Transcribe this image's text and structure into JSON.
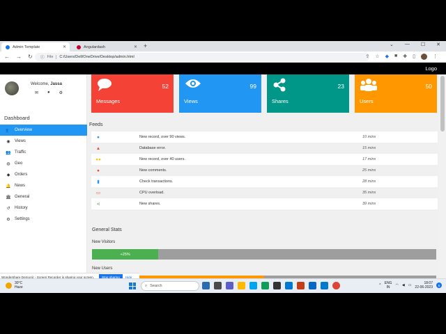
{
  "browser": {
    "tabs": [
      {
        "label": "Admin Template",
        "active": true,
        "favicon_color": "#1a73e8"
      },
      {
        "label": "Angulardash",
        "active": false,
        "favicon_color": "#c3002f"
      }
    ],
    "file_label": "File",
    "url": "C:/Users/Dell/OneDrive/Desktop/admin.html"
  },
  "topbar": {
    "logo": "Logo"
  },
  "sidebar": {
    "welcome_prefix": "Welcome, ",
    "user_name": "Jassa",
    "section_title": "Dashboard",
    "items": [
      {
        "label": "Overview",
        "icon": "users-icon",
        "active": true
      },
      {
        "label": "Views",
        "icon": "eye-icon",
        "active": false
      },
      {
        "label": "Traffic",
        "icon": "users-icon",
        "active": false
      },
      {
        "label": "Geo",
        "icon": "globe-icon",
        "active": false
      },
      {
        "label": "Orders",
        "icon": "diamond-icon",
        "active": false
      },
      {
        "label": "News",
        "icon": "bell-icon",
        "active": false
      },
      {
        "label": "General",
        "icon": "bank-icon",
        "active": false
      },
      {
        "label": "History",
        "icon": "history-icon",
        "active": false
      },
      {
        "label": "Settings",
        "icon": "gear-icon",
        "active": false
      }
    ]
  },
  "cards": [
    {
      "label": "Messages",
      "value": "52",
      "color": "#f44336",
      "icon": "comment-icon"
    },
    {
      "label": "Views",
      "value": "99",
      "color": "#2196f3",
      "icon": "eye-icon"
    },
    {
      "label": "Shares",
      "value": "23",
      "color": "#009688",
      "icon": "share-icon"
    },
    {
      "label": "Users",
      "value": "50",
      "color": "#ff9800",
      "icon": "users-icon"
    }
  ],
  "feeds": {
    "title": "Feeds",
    "rows": [
      {
        "icon": "user-icon",
        "color": "#2196f3",
        "text": "New record, over 90 views.",
        "time": "10 mins"
      },
      {
        "icon": "bell-icon",
        "color": "#f44336",
        "text": "Database error.",
        "time": "15 mins"
      },
      {
        "icon": "users-icon",
        "color": "#ffc107",
        "text": "New record, over 40 users.",
        "time": "17 mins"
      },
      {
        "icon": "comment-icon",
        "color": "#f44336",
        "text": "New comments.",
        "time": "25 mins"
      },
      {
        "icon": "bookmark-icon",
        "color": "#2196f3",
        "text": "Check transactions.",
        "time": "28 mins"
      },
      {
        "icon": "laptop-icon",
        "color": "#f44336",
        "text": "CPU overload.",
        "time": "35 mins"
      },
      {
        "icon": "share-icon",
        "color": "#4caf50",
        "text": "New shares.",
        "time": "39 mins"
      }
    ]
  },
  "stats": {
    "title": "General Stats",
    "bars": [
      {
        "label": "New Visitors",
        "percent": 25,
        "text": "+25%",
        "color": "#4caf50"
      },
      {
        "label": "New Users",
        "percent": 50,
        "text": "",
        "color": "#ff9800"
      }
    ]
  },
  "share_notice": {
    "text": "Wondershare DemoAir - Screen Recorder is sharing your screen.",
    "stop": "Stop sharing",
    "hide": "Hide"
  },
  "taskbar": {
    "temp": "30°C",
    "weather": "Haze",
    "search": "Search",
    "lang_1": "ENG",
    "lang_2": "IN",
    "time": "18:07",
    "date": "22-06-2023",
    "notif_count": "5"
  }
}
